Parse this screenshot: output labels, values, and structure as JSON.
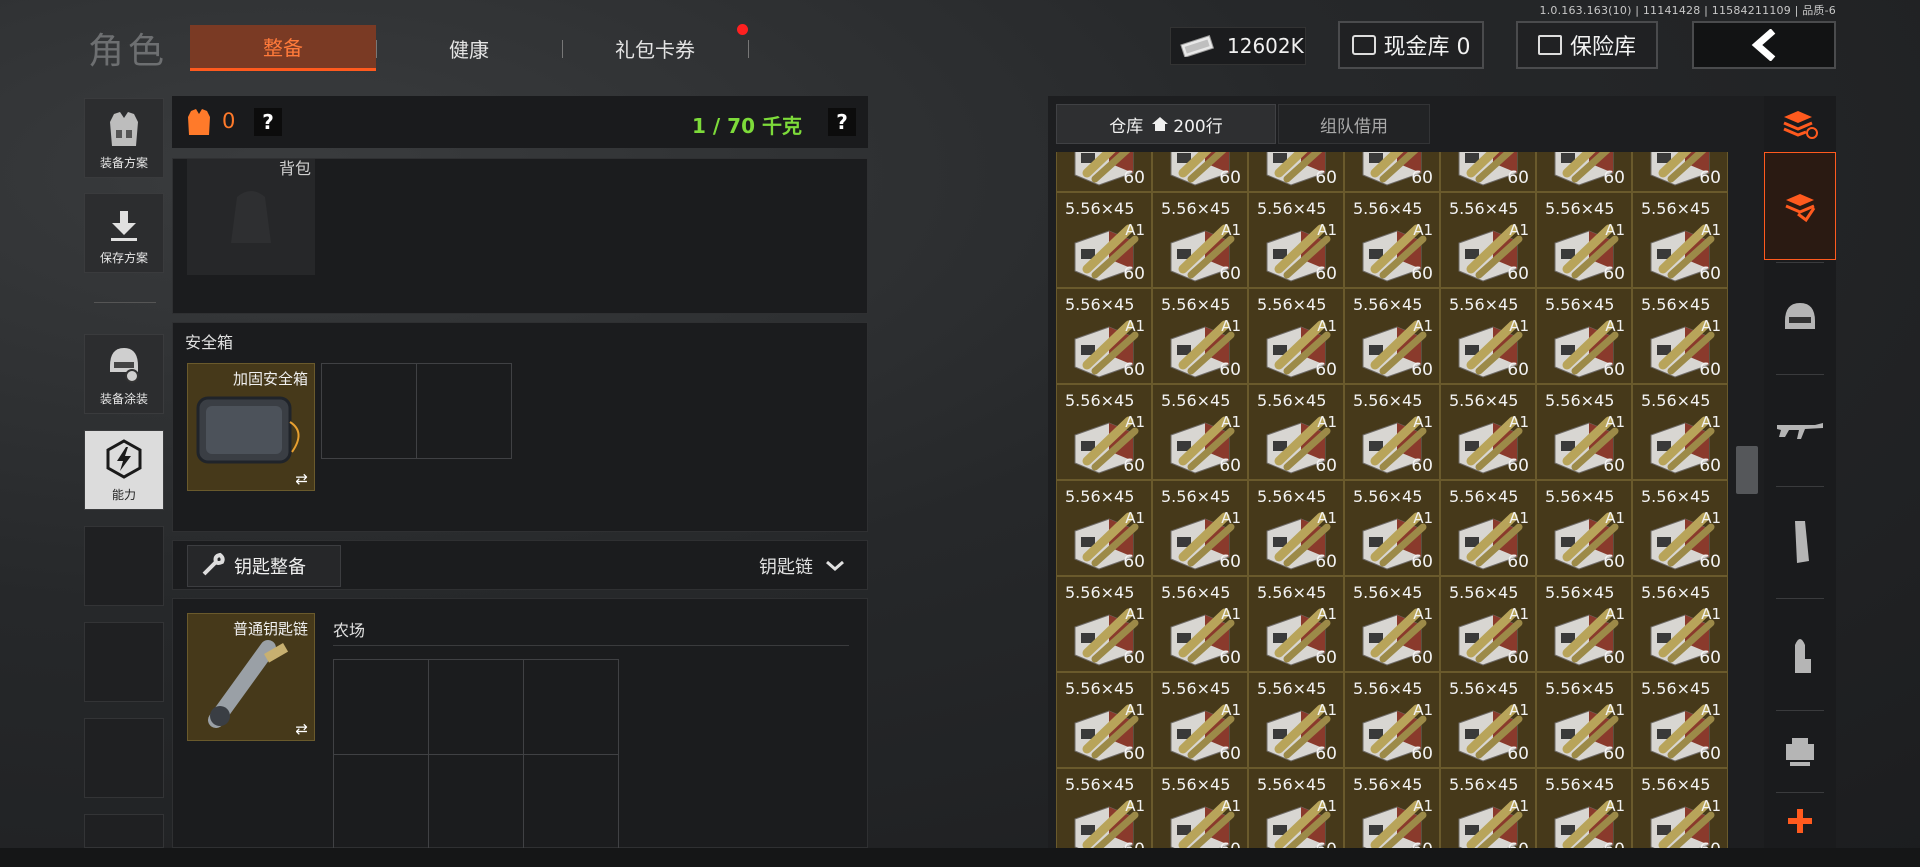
{
  "version": "1.0.163.163(10) | 11141428 | 11584211109 | 品质-6",
  "page_title": "角色",
  "tabs": [
    {
      "label": "整备",
      "active": true
    },
    {
      "label": "健康",
      "active": false
    },
    {
      "label": "礼包卡券",
      "active": false,
      "has_notification": true
    }
  ],
  "header": {
    "cash": "12602K",
    "cash_vault_label": "现金库 0",
    "safe_label": "保险库",
    "back_icon": "chevron-left-icon"
  },
  "sidebar": [
    {
      "label": "装备方案",
      "icon": "vest-icon"
    },
    {
      "label": "保存方案",
      "icon": "download-icon"
    },
    {
      "label": "装备涂装",
      "icon": "helmet-icon"
    },
    {
      "label": "能力",
      "icon": "lightning-hexagon-icon"
    }
  ],
  "loadout": {
    "armor_count": "0",
    "weight": "1 / 70 千克",
    "backpack_label": "背包",
    "safebox_title": "安全箱",
    "safebox_item": "加固安全箱",
    "key_button": "钥匙整备",
    "key_dropdown": "钥匙链",
    "keychain_item": "普通钥匙链",
    "keychain_map": "农场"
  },
  "warehouse": {
    "tab_storage": "仓库",
    "tab_storage_rows": "200行",
    "tab_team": "组队借用",
    "item": {
      "caliber": "5.56×45",
      "variant": "A1",
      "count": "60"
    },
    "columns": 7,
    "rows": 8,
    "item_color": "#46391a"
  },
  "categories": [
    "sort-icon",
    "all-items-icon",
    "helmet-icon",
    "rifle-icon",
    "magazine-icon",
    "ammo-icon",
    "attachment-icon",
    "add-icon"
  ],
  "colors": {
    "accent": "#ff5a1e",
    "weight_green": "#7ddb3a",
    "armor_orange": "#ff7a2a"
  }
}
